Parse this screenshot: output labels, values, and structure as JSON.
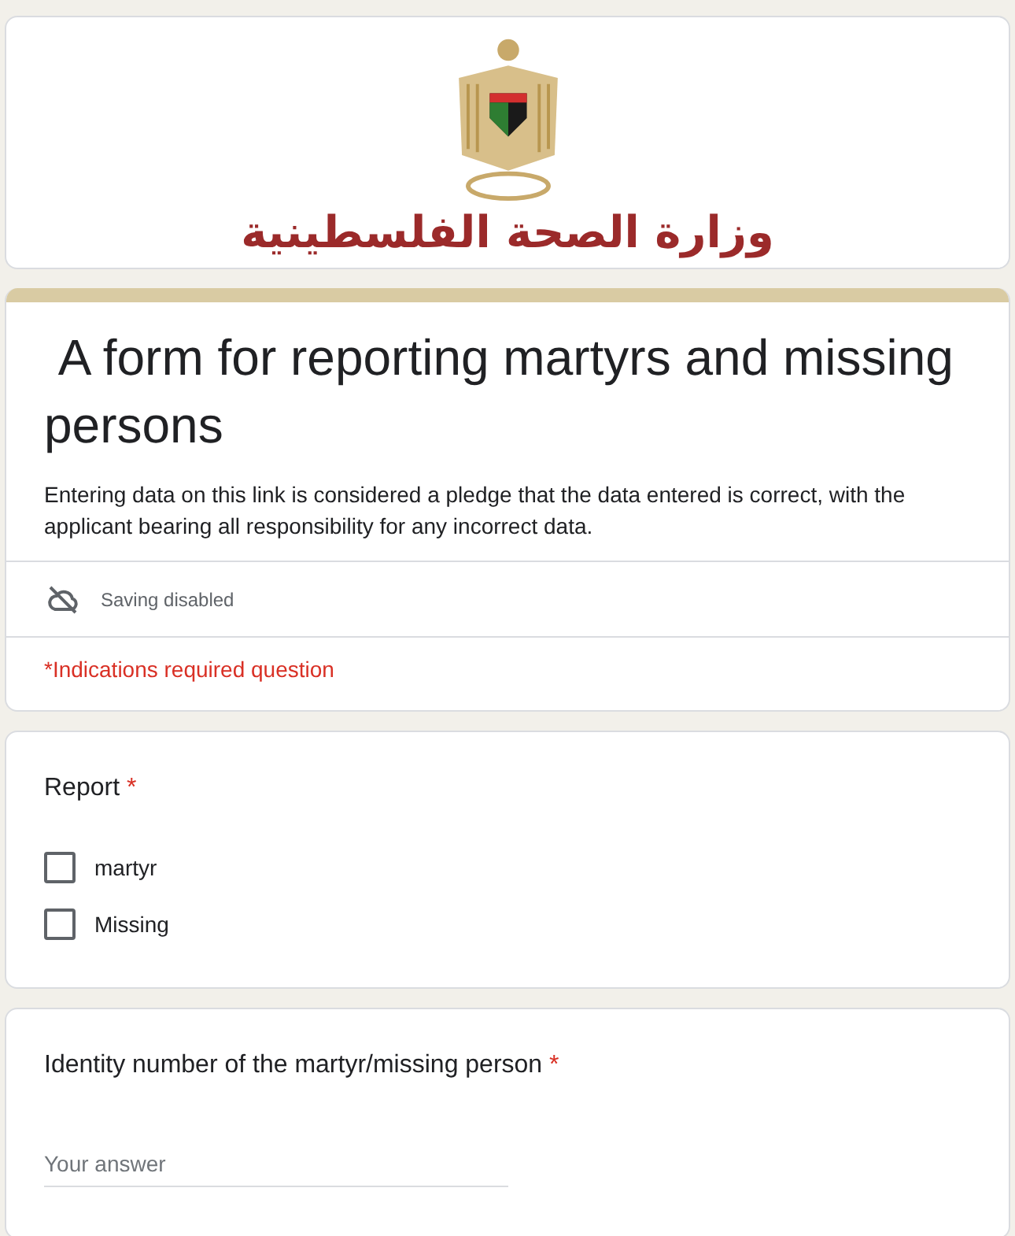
{
  "header": {
    "logo_text": "وزارة الصحة الفلسطينية"
  },
  "form": {
    "title": " A form for reporting martyrs and missing persons",
    "description": "Entering data on this link is considered a pledge that the data entered is correct, with the applicant bearing all responsibility for any incorrect data.",
    "saving_status": "Saving disabled",
    "required_note": "*Indications required question"
  },
  "questions": [
    {
      "kind": "checkbox",
      "title": "Report",
      "required": true,
      "required_mark": "*",
      "options": [
        {
          "label": "martyr",
          "checked": false
        },
        {
          "label": "Missing",
          "checked": false
        }
      ]
    },
    {
      "kind": "text",
      "title": "Identity number of the martyr/missing person",
      "required": true,
      "required_mark": "*",
      "placeholder": "Your answer"
    }
  ]
}
